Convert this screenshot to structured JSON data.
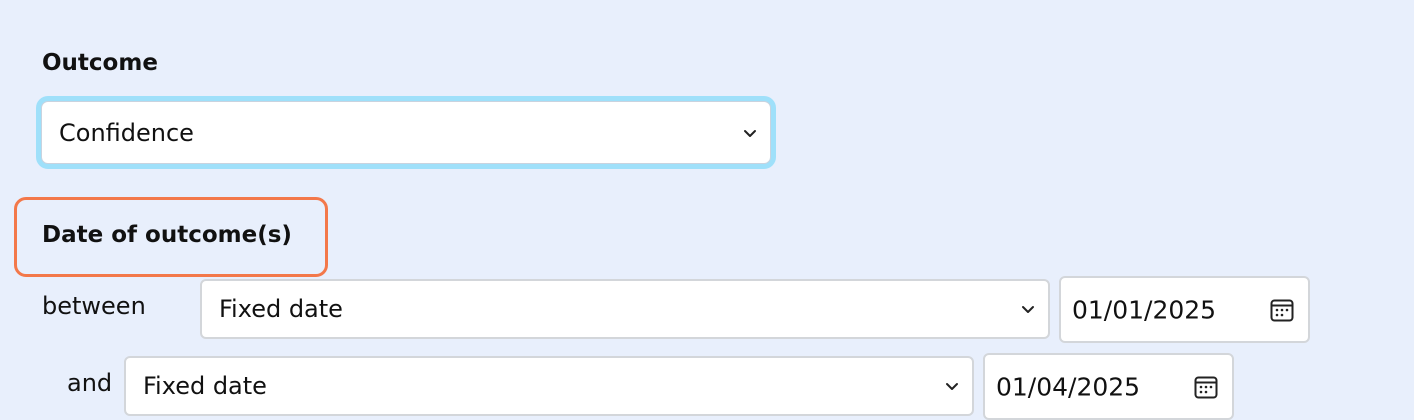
{
  "outcome": {
    "label": "Outcome",
    "selected": "Confidence"
  },
  "date_section": {
    "heading": "Date of outcome(s)",
    "between": {
      "label": "between",
      "type_selected": "Fixed date",
      "date_value": "01/01/2025"
    },
    "and": {
      "label": "and",
      "type_selected": "Fixed date",
      "date_value": "01/04/2025"
    }
  },
  "colors": {
    "background": "#e8effc",
    "focus_ring": "#9fe0fa",
    "highlight_border": "#f3784a",
    "field_border": "#d3d6da"
  },
  "icons": {
    "dropdown": "chevron-down-icon",
    "date_picker": "calendar-icon"
  }
}
